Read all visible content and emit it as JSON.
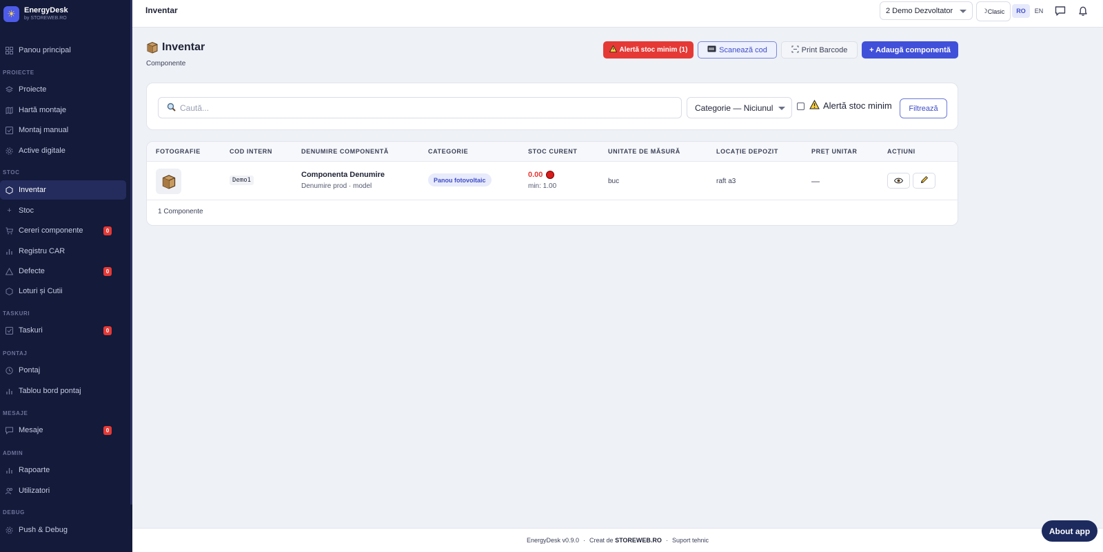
{
  "brand": {
    "name": "EnergyDesk",
    "sub": "by STOREWEB.RO"
  },
  "sidebar": {
    "sections": {
      "proiecte": "PROIECTE",
      "stoc": "STOC",
      "taskuri": "TASKURI",
      "pontaj": "PONTAJ",
      "mesaje": "MESAJE",
      "admin": "ADMIN",
      "debug": "DEBUG"
    },
    "items": {
      "dashboard": "Panou principal",
      "proiecte": "Proiecte",
      "harta": "Hartă montaje",
      "montaj": "Montaj manual",
      "active": "Active digitale",
      "inventar": "Inventar",
      "stoc": "Stoc",
      "cereri": "Cereri componente",
      "registru": "Registru CAR",
      "defecte": "Defecte",
      "loturi": "Loturi și Cutii",
      "taskuri": "Taskuri",
      "pontaj": "Pontaj",
      "tablou": "Tablou bord pontaj",
      "mesaje": "Mesaje",
      "rapoarte": "Rapoarte",
      "utilizatori": "Utilizatori",
      "push": "Push & Debug"
    },
    "badges": {
      "cereri": "0",
      "defecte": "0",
      "taskuri": "0",
      "mesaje": "0"
    }
  },
  "topbar": {
    "title": "Inventar",
    "team": "2 Demo Dezvoltator",
    "mode": "Clasic",
    "mode_icon": "☽",
    "lang_ro": "RO",
    "lang_en": "EN"
  },
  "page": {
    "title": "Inventar",
    "subtitle": "Componente",
    "alert_button": "Alertă stoc minim (1)",
    "scan_button": "Scanează cod",
    "print_button": "Print Barcode",
    "add_button": "+ Adaugă componentă"
  },
  "filters": {
    "search_placeholder": "Caută...",
    "category": "Categorie — Niciunul",
    "min_stock_label": "Alertă stoc minim",
    "filter_button": "Filtrează"
  },
  "table": {
    "headers": [
      "FOTOGRAFIE",
      "COD INTERN",
      "DENUMIRE COMPONENTĂ",
      "CATEGORIE",
      "STOC CURENT",
      "UNITATE DE MĂSURĂ",
      "LOCAȚIE DEPOZIT",
      "PREȚ UNITAR",
      "ACȚIUNI"
    ],
    "rows": [
      {
        "code": "Demo1",
        "name": "Componenta Denumire",
        "model": "Denumire prod · model",
        "category": "Panou fotovoltaic",
        "stock": "0.00",
        "min": "min: 1.00",
        "unit": "buc",
        "location": "raft a3",
        "price": "—"
      }
    ],
    "footer": "1 Componente"
  },
  "footer": {
    "version": "EnergyDesk v0.9.0",
    "sep": "·",
    "created": "Creat de",
    "company": "STOREWEB.RO",
    "support": "Suport tehnic"
  },
  "about": "About app",
  "colors": {
    "sidebar_bg": "#131a3a",
    "accent": "#4150d9",
    "alert": "#e53935"
  }
}
